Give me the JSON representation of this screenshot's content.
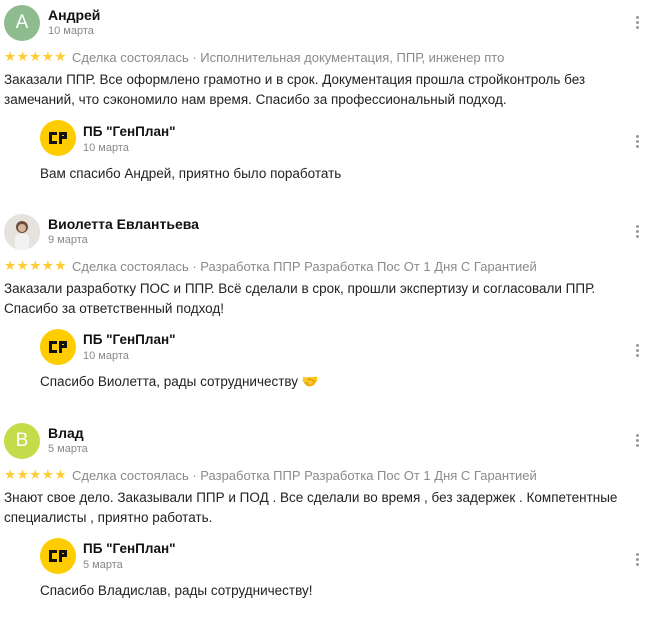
{
  "reviews": [
    {
      "initial": "А",
      "avatar_color": "#8fbc8f",
      "author": "Андрей",
      "date": "10 марта",
      "rating": 5,
      "meta": "Сделка состоялась · Исполнительная документация, ППР, инженер пто",
      "text": "Заказали ППР. Все оформлено грамотно и в срок. Документация прошла стройконтроль без замечаний, что сэкономило нам время. Спасибо за профессиональный подход.",
      "reply": {
        "author": "ПБ \"ГенПлан\"",
        "date": "10 марта",
        "text": "Вам спасибо Андрей, приятно было поработать"
      }
    },
    {
      "initial": "",
      "avatar_color": "#e8e4e0",
      "author": "Виолетта Евлантьева",
      "date": "9 марта",
      "rating": 5,
      "meta": "Сделка состоялась · Разработка ППР Разработка Пос От 1 Дня С Гарантией",
      "text": "Заказали разработку ПОС и ППР. Всё сделали в срок, прошли экспертизу и согласовали ППР. Спасибо за ответственный подход!",
      "reply": {
        "author": "ПБ \"ГенПлан\"",
        "date": "10 марта",
        "text": "Спасибо Виолетта, рады сотрудничеству 🤝"
      }
    },
    {
      "initial": "В",
      "avatar_color": "#c5dc4a",
      "author": "Влад",
      "date": "5 марта",
      "rating": 5,
      "meta": "Сделка состоялась · Разработка ППР Разработка Пос От 1 Дня С Гарантией",
      "text": "Знают свое дело. Заказывали ППР и ПОД . Все сделали во время , без задержек . Компетентные специалисты , приятно работать.",
      "reply": {
        "author": "ПБ \"ГенПлан\"",
        "date": "5 марта",
        "text": "Спасибо Владислав, рады сотрудничеству!"
      }
    }
  ],
  "stars_glyph": "★★★★★",
  "accent_yellow": "#ffcc00",
  "icons": {
    "menu": "more-vertical-icon",
    "logo": "genplan-logo-icon"
  }
}
